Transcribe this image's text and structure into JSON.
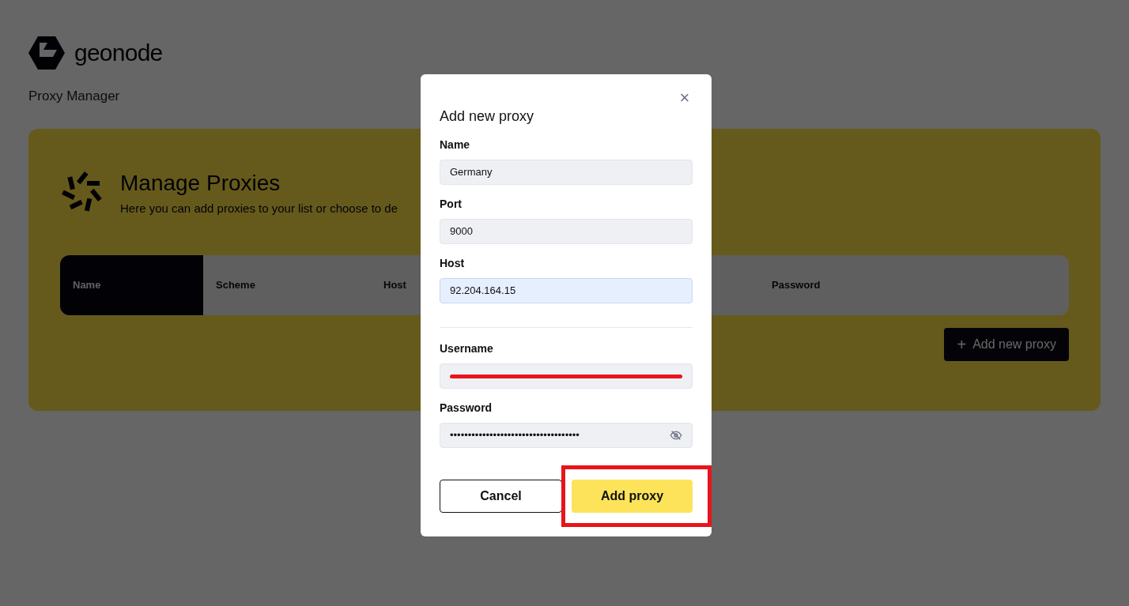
{
  "brand": {
    "name": "geonode"
  },
  "page_title": "Proxy Manager",
  "card": {
    "title": "Manage Proxies",
    "subtitle": "Here you can add proxies to your list or choose to de"
  },
  "table": {
    "columns": [
      {
        "label": "Name",
        "selected": true
      },
      {
        "label": "Scheme",
        "selected": false
      },
      {
        "label": "Host",
        "selected": false
      },
      {
        "label": "Password",
        "selected": false
      }
    ]
  },
  "add_button": {
    "icon": "+",
    "label": "Add new proxy"
  },
  "dialog": {
    "title": "Add new proxy",
    "close": "×",
    "fields": [
      {
        "kind": "text",
        "label": "Name",
        "value": "Germany",
        "focused": false
      },
      {
        "kind": "text",
        "label": "Port",
        "value": "9000",
        "focused": false
      },
      {
        "kind": "text",
        "label": "Host",
        "value": "92.204.164.15",
        "focused": true
      },
      {
        "kind": "divider"
      },
      {
        "kind": "redacted",
        "label": "Username"
      },
      {
        "kind": "password",
        "label": "Password",
        "value": "••••••••••••••••••••••••••••••••••••"
      }
    ],
    "cancel": "Cancel",
    "submit": "Add proxy",
    "submit_highlighted": true
  }
}
